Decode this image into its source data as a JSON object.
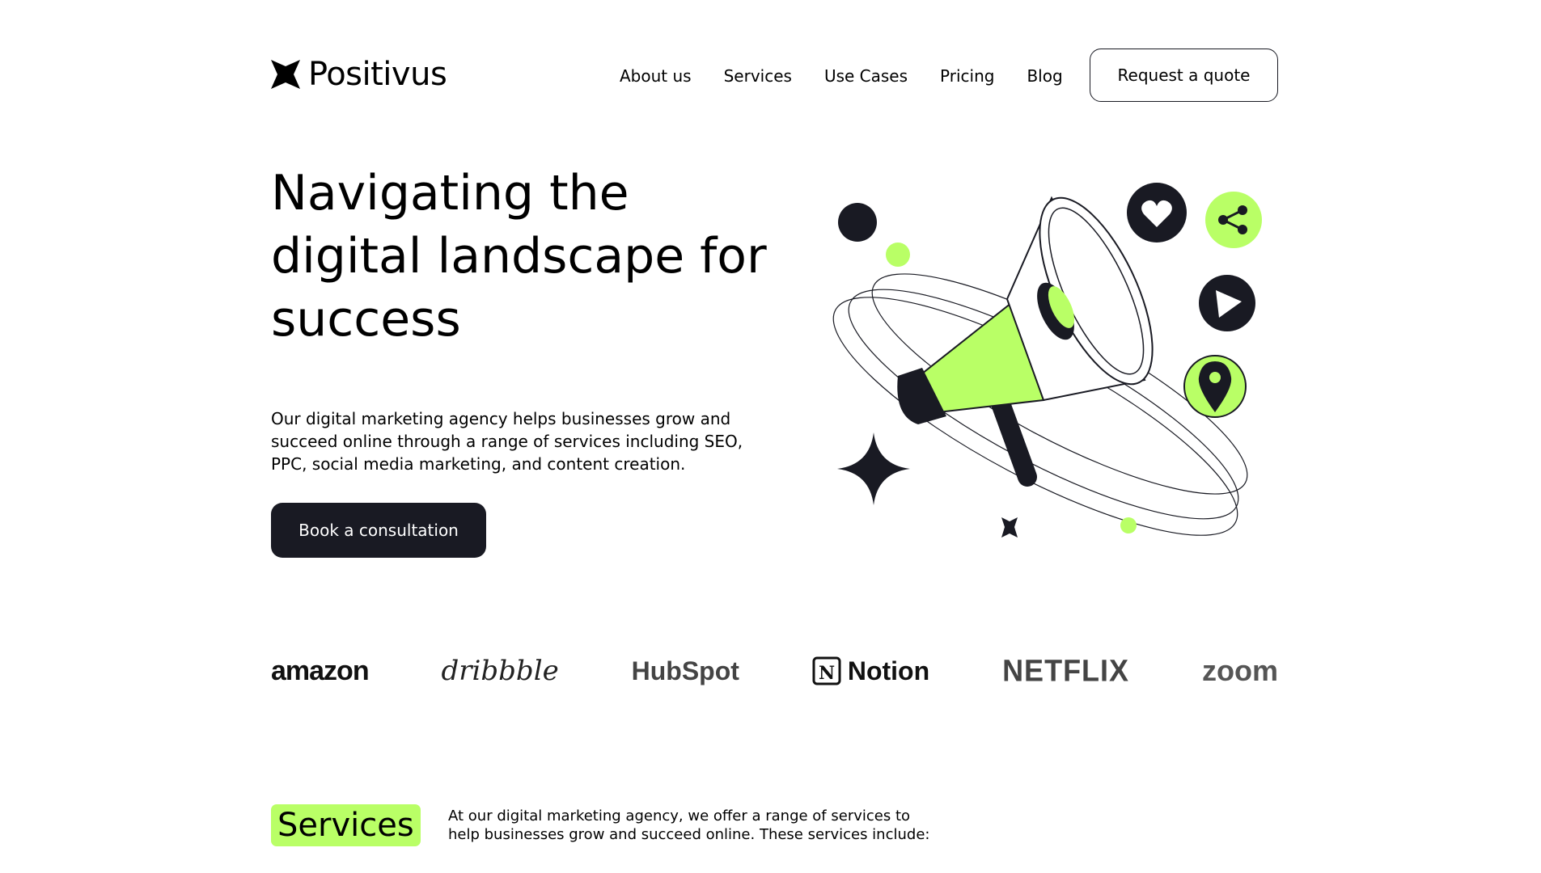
{
  "header": {
    "logo_text": "Positivus",
    "nav": [
      "About us",
      "Services",
      "Use Cases",
      "Pricing",
      "Blog"
    ],
    "quote_button": "Request a quote"
  },
  "hero": {
    "title": "Navigating the digital landscape for success",
    "description": "Our digital marketing agency helps businesses grow and succeed online through a range of services including SEO, PPC, social media marketing, and content creation.",
    "cta": "Book a consultation"
  },
  "brands": [
    "amazon",
    "dribbble",
    "HubSpot",
    "Notion",
    "NETFLIX",
    "zoom"
  ],
  "services": {
    "tag": "Services",
    "description": "At our digital marketing agency, we offer a range of services to help businesses grow and succeed online. These services include:"
  },
  "colors": {
    "accent": "#B9FF66",
    "dark": "#191A23",
    "background": "#FFFFFF"
  }
}
